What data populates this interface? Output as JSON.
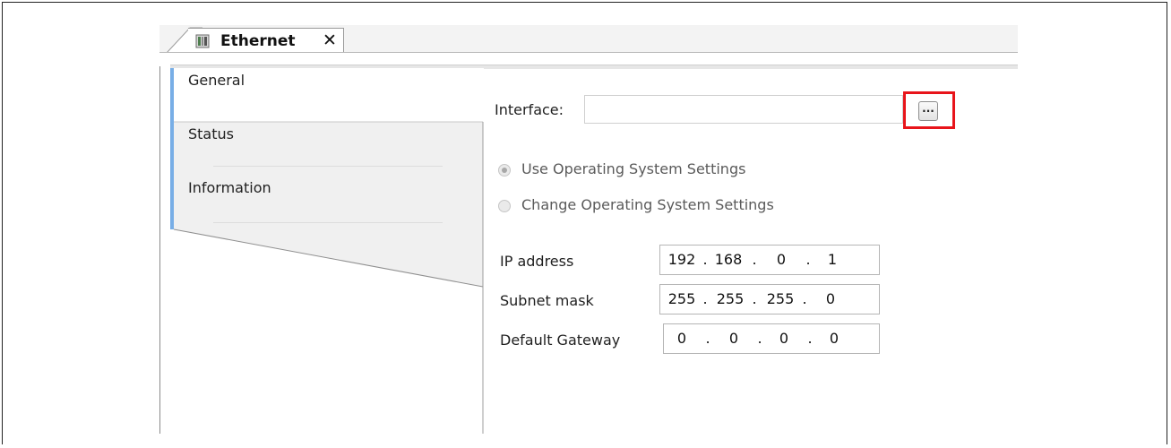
{
  "tab": {
    "title": "Ethernet",
    "close": "✕"
  },
  "nav": {
    "items": [
      {
        "label": "General",
        "selected": true
      },
      {
        "label": "Status",
        "selected": false
      },
      {
        "label": "Information",
        "selected": false
      }
    ]
  },
  "interface": {
    "label": "Interface:",
    "value": "",
    "browse_label": "..."
  },
  "settings": {
    "use_os": "Use Operating System Settings",
    "change_os": "Change Operating System Settings",
    "selected": "use_os"
  },
  "network": {
    "ip_label": "IP address",
    "ip": [
      "192",
      "168",
      "0",
      "1"
    ],
    "subnet_label": "Subnet mask",
    "subnet": [
      "255",
      "255",
      "255",
      "0"
    ],
    "gateway_label": "Default Gateway",
    "gateway": [
      "0",
      "0",
      "0",
      "0"
    ]
  },
  "colors": {
    "highlight": "#e8141a",
    "nav_accent": "#78aee6"
  }
}
